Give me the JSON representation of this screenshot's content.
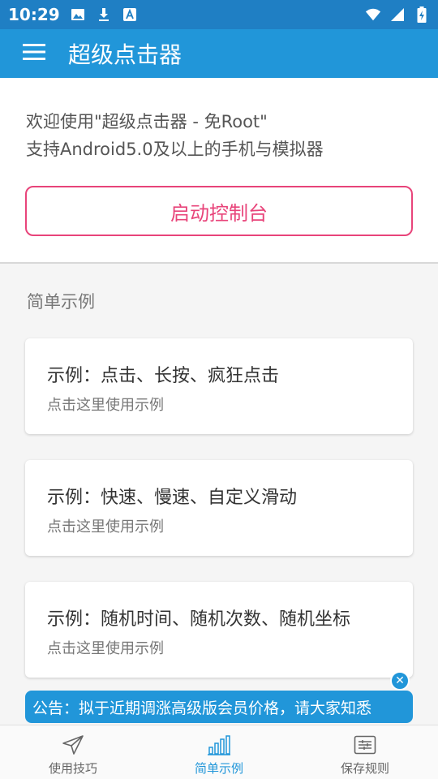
{
  "status_bar": {
    "time": "10:29",
    "left_icons": [
      "image-icon",
      "download-icon",
      "text-a-icon"
    ],
    "right_icons": [
      "wifi-icon",
      "signal-icon",
      "battery-charging-icon"
    ]
  },
  "app_bar": {
    "title": "超级点击器",
    "menu_icon": "hamburger-menu-icon"
  },
  "welcome": {
    "line1": "欢迎使用\"超级点击器 - 免Root\"",
    "line2": "支持Android5.0及以上的手机与模拟器",
    "button_label": "启动控制台"
  },
  "examples": {
    "section_title": "简单示例",
    "cards": [
      {
        "title": "示例：点击、长按、疯狂点击",
        "subtitle": "点击这里使用示例"
      },
      {
        "title": "示例：快速、慢速、自定义滑动",
        "subtitle": "点击这里使用示例"
      },
      {
        "title": "示例：随机时间、随机次数、随机坐标",
        "subtitle": "点击这里使用示例"
      }
    ]
  },
  "notice": {
    "text": "公告：拟于近期调涨高级版会员价格，请大家知悉"
  },
  "bottom_nav": {
    "items": [
      {
        "label": "使用技巧",
        "icon": "send-icon",
        "active": false
      },
      {
        "label": "简单示例",
        "icon": "bar-chart-icon",
        "active": true
      },
      {
        "label": "保存规则",
        "icon": "sliders-icon",
        "active": false
      }
    ]
  },
  "colors": {
    "status_bar": "#1f7fc4",
    "primary": "#2196d9",
    "accent": "#e8447a"
  }
}
